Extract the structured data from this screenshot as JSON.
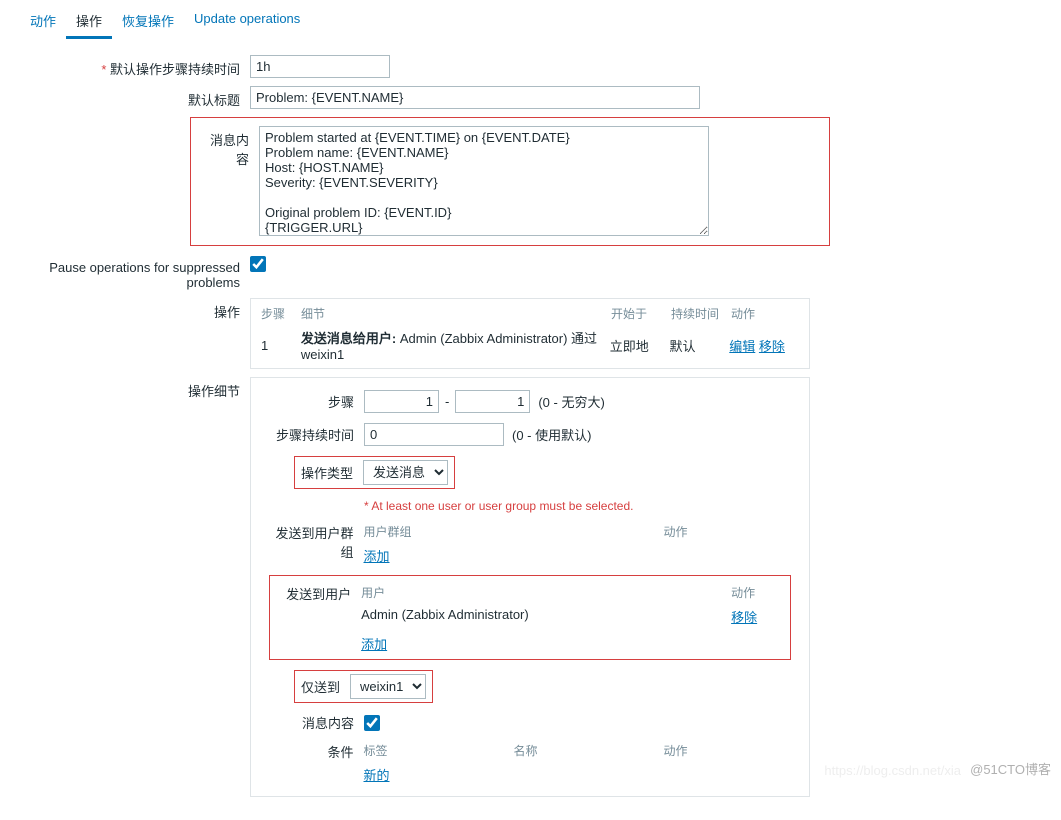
{
  "tabs": {
    "action": "动作",
    "operations": "操作",
    "recovery": "恢复操作",
    "update": "Update operations"
  },
  "form": {
    "default_step_duration_label": "默认操作步骤持续时间",
    "default_step_duration_value": "1h",
    "default_subject_label": "默认标题",
    "default_subject_value": "Problem: {EVENT.NAME}",
    "message_label": "消息内容",
    "message_value": "Problem started at {EVENT.TIME} on {EVENT.DATE}\nProblem name: {EVENT.NAME}\nHost: {HOST.NAME}\nSeverity: {EVENT.SEVERITY}\n\nOriginal problem ID: {EVENT.ID}\n{TRIGGER.URL}",
    "pause_label": "Pause operations for suppressed problems",
    "operations_label": "操作"
  },
  "ops_table": {
    "col_steps": "步骤",
    "col_details": "细节",
    "col_start": "开始于",
    "col_duration": "持续时间",
    "col_action": "动作",
    "row_step": "1",
    "row_details_prefix": "发送消息给用户:",
    "row_details_value": " Admin (Zabbix Administrator) 通过 weixin1",
    "row_start": "立即地",
    "row_duration": "默认",
    "edit": "编辑",
    "remove": "移除"
  },
  "details": {
    "section_label": "操作细节",
    "steps_label": "步骤",
    "step_from": "1",
    "step_to": "1",
    "step_hint": "(0 - 无穷大)",
    "step_duration_label": "步骤持续时间",
    "step_duration_value": "0",
    "step_duration_hint": "(0 - 使用默认)",
    "op_type_label": "操作类型",
    "op_type_value": "发送消息",
    "warn_text": "At least one user or user group must be selected.",
    "send_groups_label": "发送到用户群组",
    "col_usergroup": "用户群组",
    "col_action": "动作",
    "add": "添加",
    "send_users_label": "发送到用户",
    "col_user": "用户",
    "user_value": "Admin (Zabbix Administrator)",
    "remove": "移除",
    "only_to_label": "仅送到",
    "only_to_value": "weixin1",
    "msg_content_label": "消息内容",
    "conditions_label": "条件",
    "col_label": "标签",
    "col_name": "名称",
    "new": "新的"
  },
  "watermark": "@51CTO博客",
  "watermark_faint": "https://blog.csdn.net/xia"
}
